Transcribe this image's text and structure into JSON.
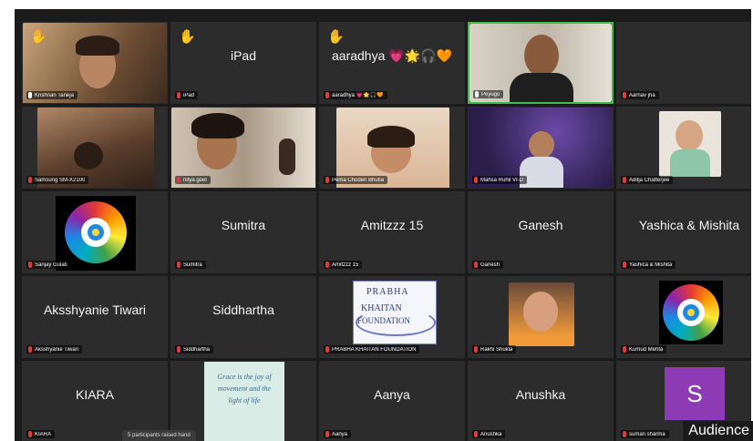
{
  "corner_label": "Audience",
  "toast": "5 participants raised hand",
  "tiles": [
    {
      "name": "Krishnan Taneja",
      "center": "",
      "hand": true
    },
    {
      "name": "iPad",
      "center": "iPad",
      "hand": true
    },
    {
      "name": "aaradhya 💗🌟🎧🧡",
      "center": "aaradhya 💗🌟🎧🧡",
      "hand": true
    },
    {
      "name": "Peyugo",
      "center": "",
      "hand": false
    },
    {
      "name": "Aarnav jha",
      "center": "",
      "hand": false
    },
    {
      "name": "Samsung SM-X2100",
      "center": "",
      "hand": false
    },
    {
      "name": "nitya goel",
      "center": "",
      "hand": false
    },
    {
      "name": "Pema Choden Bhutia",
      "center": "",
      "hand": false
    },
    {
      "name": "Mahsa Ruhil VI-D",
      "center": "",
      "hand": false
    },
    {
      "name": "Aditja Chatterjee",
      "center": "",
      "hand": false
    },
    {
      "name": "Sanjay Gulati",
      "center": "",
      "hand": false
    },
    {
      "name": "Sumitra",
      "center": "Sumitra",
      "hand": false
    },
    {
      "name": "Amitzzz 15",
      "center": "Amitzzz 15",
      "hand": false
    },
    {
      "name": "Ganesh",
      "center": "Ganesh",
      "hand": false
    },
    {
      "name": "Yashica & Mishita",
      "center": "Yashica & Mishita",
      "hand": false
    },
    {
      "name": "Aksshyanie Tiwari",
      "center": "Aksshyanie Tiwari",
      "hand": false
    },
    {
      "name": "Siddhartha",
      "center": "Siddhartha",
      "hand": false
    },
    {
      "name": "PRABHA KHAITAN FOUNDATION",
      "center": "",
      "hand": false
    },
    {
      "name": "Rakhi Shukla",
      "center": "",
      "hand": false
    },
    {
      "name": "Kumud Mehta",
      "center": "",
      "hand": false
    },
    {
      "name": "KIARA",
      "center": "KIARA",
      "hand": false
    },
    {
      "name": "",
      "center": "",
      "hand": false
    },
    {
      "name": "Aanya",
      "center": "Aanya",
      "hand": false
    },
    {
      "name": "Anushka",
      "center": "Anushka",
      "hand": false
    },
    {
      "name": "suman sharma",
      "center": "",
      "hand": false
    }
  ],
  "logos": {
    "prabha_line1": "PRABHA",
    "prabha_line2": "KHAITAN",
    "prabha_line3": "FOUNDATION",
    "avatar_letter": "S",
    "quote": "Grace is the joy of movement and the light of life"
  },
  "colors": {
    "background": "#1b1b1b",
    "tile": "#2c2c2c",
    "active_border": "#3bbf4a",
    "muted_mic": "#e0393e",
    "avatar": "#8c3bb4"
  }
}
